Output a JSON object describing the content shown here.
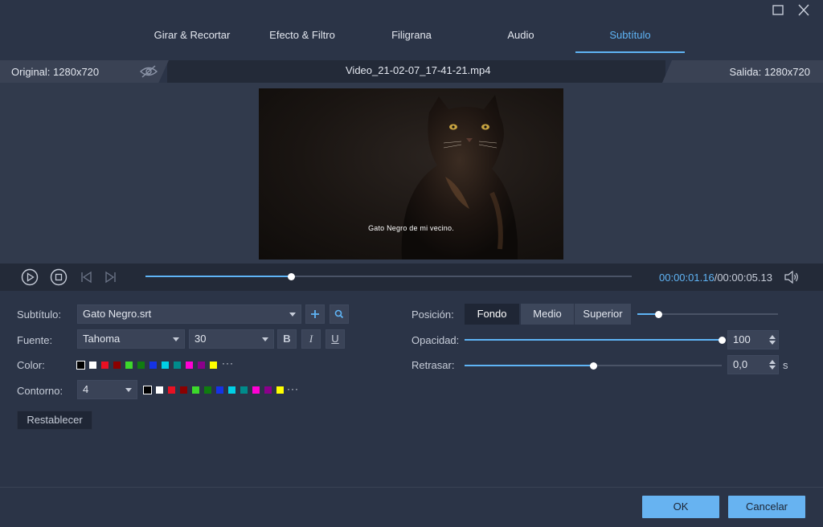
{
  "tabs": [
    {
      "label": "Girar & Recortar"
    },
    {
      "label": "Efecto & Filtro"
    },
    {
      "label": "Filigrana"
    },
    {
      "label": "Audio"
    },
    {
      "label": "Subtítulo"
    }
  ],
  "active_tab": "Subtítulo",
  "info": {
    "original": "Original: 1280x720",
    "filename": "Video_21-02-07_17-41-21.mp4",
    "output": "Salida: 1280x720"
  },
  "preview": {
    "subtitle_text": "Gato Negro de mi vecino."
  },
  "player": {
    "progress": 0.3,
    "current_time": "00:00:01.16",
    "separator": "/",
    "total_time": "00:00:05.13"
  },
  "form": {
    "subtitle_label": "Subtítulo:",
    "subtitle_file": "Gato Negro.srt",
    "font_label": "Fuente:",
    "font_name": "Tahoma",
    "font_size": "30",
    "bold": "B",
    "italic": "I",
    "underline": "U",
    "color_label": "Color:",
    "outline_label": "Contorno:",
    "outline_value": "4",
    "more": "···",
    "reset": "Restablecer",
    "position_label": "Posición:",
    "position_options": [
      "Fondo",
      "Medio",
      "Superior"
    ],
    "position_selected": "Fondo",
    "position_slider": 0.15,
    "opacity_label": "Opacidad:",
    "opacity_value": "100",
    "opacity_level": 1.0,
    "delay_label": "Retrasar:",
    "delay_value": "0,0",
    "delay_level": 0.5,
    "delay_unit": "s"
  },
  "palette": [
    "#000000",
    "#ffffff",
    "#e81123",
    "#8b0000",
    "#3cd92b",
    "#107c10",
    "#1533e6",
    "#00d0e6",
    "#008b8b",
    "#ff00d4",
    "#8b008b",
    "#ffff00"
  ],
  "footer": {
    "ok": "OK",
    "cancel": "Cancelar"
  },
  "colors": {
    "accent": "#5fb4f5",
    "background": "#2b3447"
  }
}
